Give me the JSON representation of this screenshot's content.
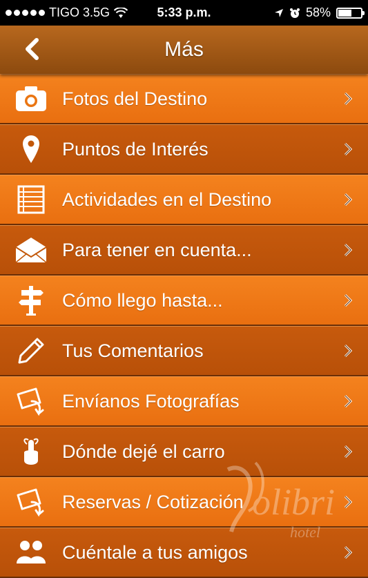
{
  "status": {
    "carrier": "TIGO 3.5G",
    "time": "5:33 p.m.",
    "battery_percent": "58%",
    "battery_level": 0.58,
    "signal_bars": 5
  },
  "nav": {
    "title": "Más",
    "back_icon": "chevron-left-icon"
  },
  "menu": [
    {
      "label": "Fotos del Destino",
      "icon": "camera-icon"
    },
    {
      "label": "Puntos de Interés",
      "icon": "map-pin-icon"
    },
    {
      "label": "Actividades en el Destino",
      "icon": "list-icon"
    },
    {
      "label": "Para tener en cuenta...",
      "icon": "envelope-icon"
    },
    {
      "label": "Cómo llego hasta...",
      "icon": "signpost-icon"
    },
    {
      "label": "Tus Comentarios",
      "icon": "pencil-icon"
    },
    {
      "label": "Envíanos Fotografías",
      "icon": "send-photo-icon"
    },
    {
      "label": "Dónde dejé el carro",
      "icon": "finger-reminder-icon"
    },
    {
      "label": "Reservas / Cotización",
      "icon": "send-photo-icon"
    },
    {
      "label": "Cuéntale a tus amigos",
      "icon": "people-icon"
    }
  ],
  "watermark": {
    "text": "Kolibri",
    "subtext": "hotel"
  },
  "colors": {
    "accent_light": "#f4821e",
    "accent_dark": "#c75a0d",
    "navbar": "#8c4a0e"
  }
}
